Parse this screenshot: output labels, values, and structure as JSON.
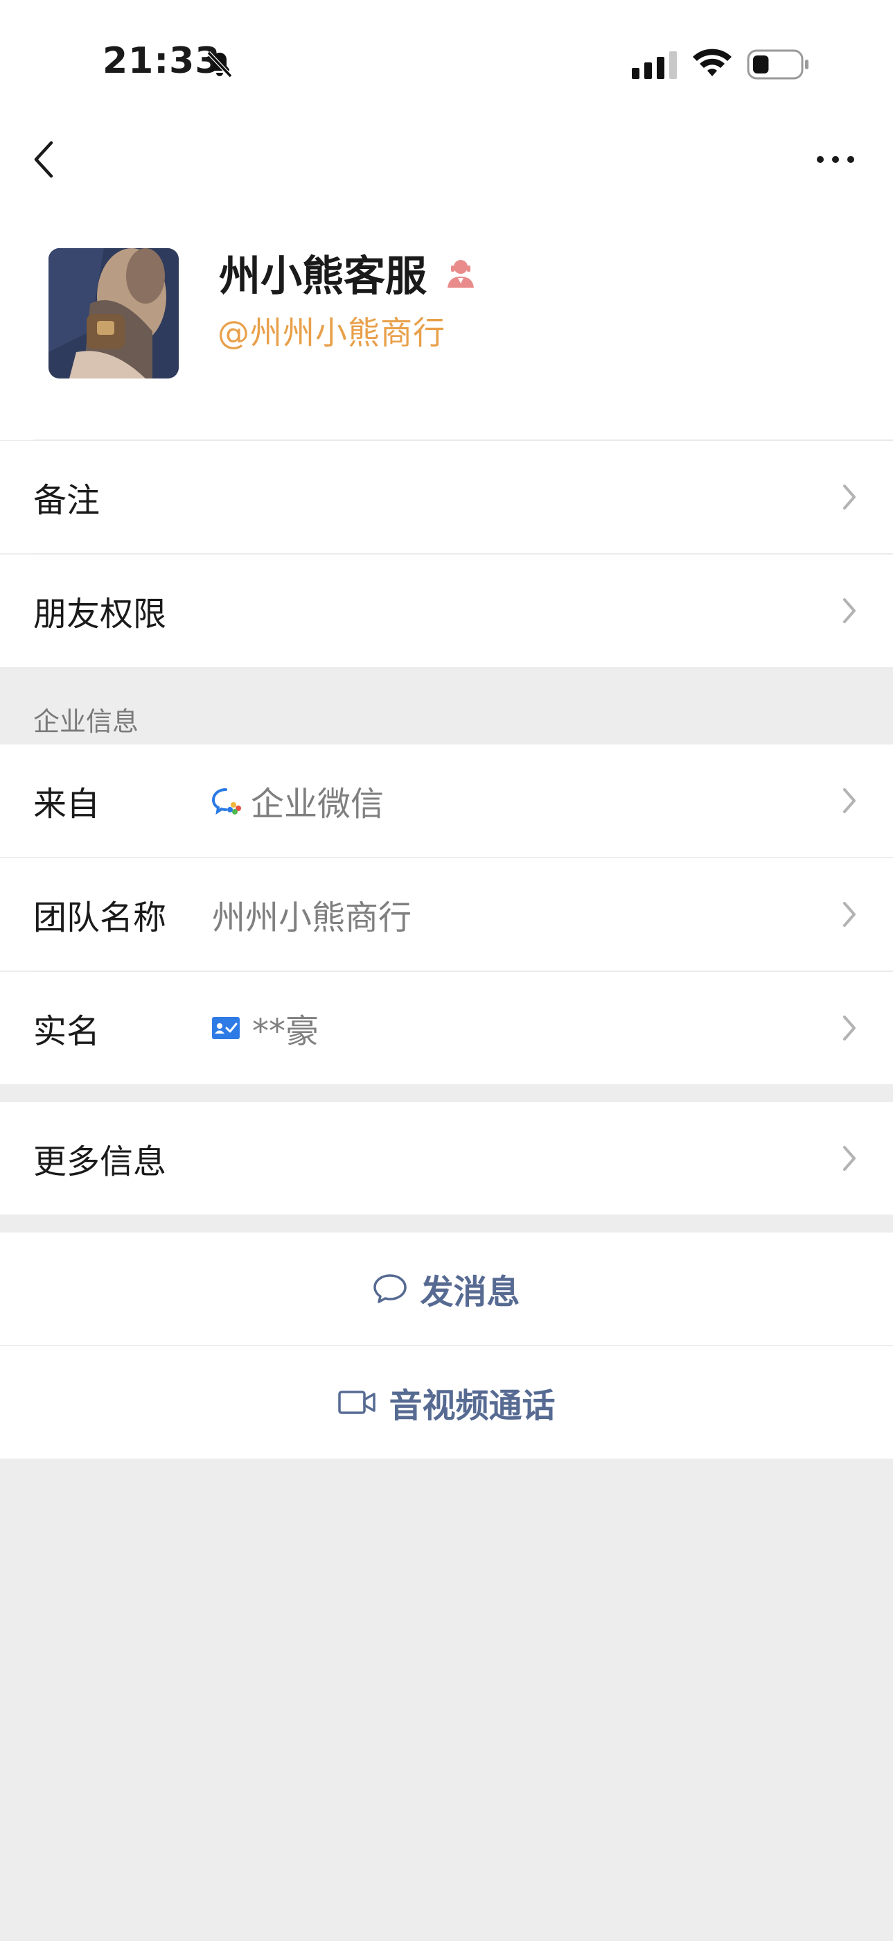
{
  "status_bar": {
    "time": "21:33",
    "mute_icon": "bell-slash-icon",
    "signal_icon": "cellular-signal-icon",
    "wifi_icon": "wifi-icon",
    "battery_icon": "battery-icon",
    "battery_level": 0.35
  },
  "nav": {
    "back_icon": "chevron-left-icon",
    "more_icon": "ellipsis-icon"
  },
  "profile": {
    "name": "州小熊客服",
    "badge_icon": "customer-service-agent-icon",
    "handle": "@州州小熊商行"
  },
  "settings": [
    {
      "label": "备注"
    },
    {
      "label": "朋友权限"
    }
  ],
  "enterprise": {
    "section_title": "企业信息",
    "rows": [
      {
        "label": "来自",
        "value": "企业微信",
        "icon": "wecom-logo-icon"
      },
      {
        "label": "团队名称",
        "value": "州州小熊商行"
      },
      {
        "label": "实名",
        "value": "**豪",
        "icon": "id-card-icon"
      }
    ]
  },
  "more_info": {
    "label": "更多信息"
  },
  "actions": {
    "message": {
      "label": "发消息",
      "icon": "chat-bubble-icon"
    },
    "call": {
      "label": "音视频通话",
      "icon": "video-camera-icon"
    }
  },
  "colors": {
    "background": "#ededed",
    "handle": "#e8a04a",
    "action_text": "#566a92",
    "badge": "#e98b8b"
  }
}
